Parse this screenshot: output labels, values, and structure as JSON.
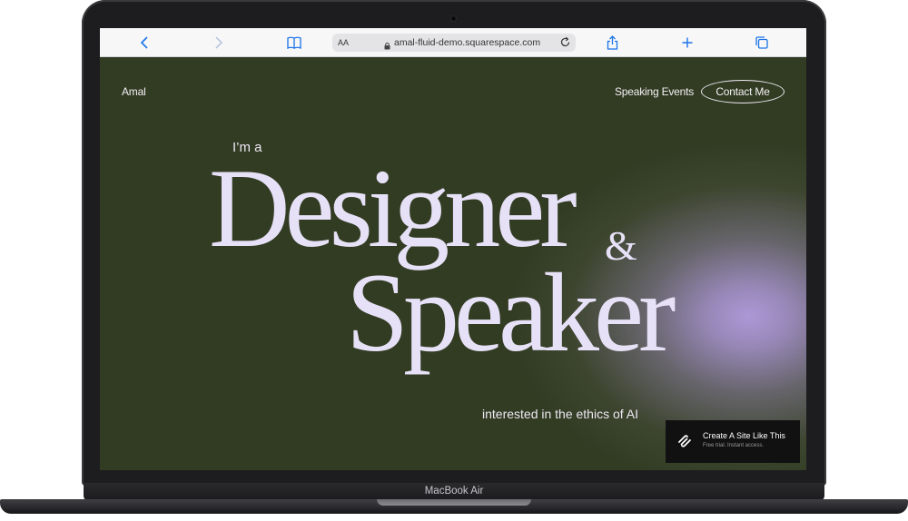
{
  "device": {
    "label": "MacBook Air"
  },
  "browser": {
    "text_size_label": "AA",
    "url": "amal-fluid-demo.squarespace.com",
    "icons": [
      "back-icon",
      "forward-icon",
      "bookmarks-icon",
      "lock-icon",
      "reload-icon",
      "share-icon",
      "new-tab-icon",
      "tabs-icon"
    ]
  },
  "site": {
    "brand": "Amal",
    "nav": {
      "speaking_events": "Speaking Events",
      "contact": "Contact Me"
    },
    "hero": {
      "lead": "I’m a",
      "word1": "Designer",
      "ampersand": "&",
      "word2": "Speaker",
      "tail": "interested in the ethics of AI"
    },
    "badge": {
      "title": "Create A Site Like This",
      "subtitle": "Free trial. Instant access.",
      "icon": "squarespace-logo-icon"
    }
  },
  "colors": {
    "background": "#323c23",
    "glow": "#ad98d6",
    "headline": "#e7e1f7",
    "link": "#1a73e8"
  }
}
